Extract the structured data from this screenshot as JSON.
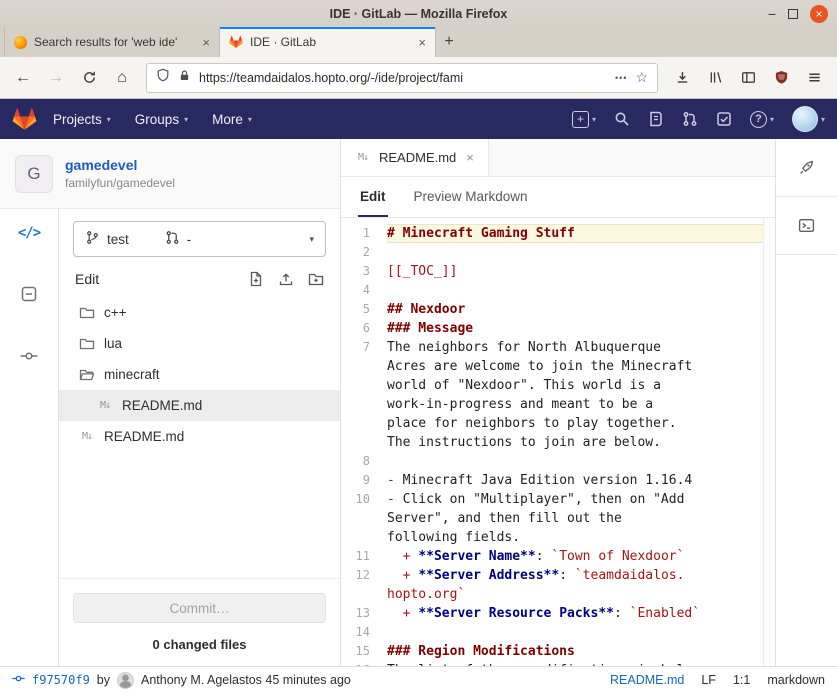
{
  "window": {
    "title": "IDE · GitLab — Mozilla Firefox"
  },
  "browser": {
    "tab1": "Search results for 'web ide'",
    "tab2": "IDE · GitLab",
    "url": "https://teamdaidalos.hopto.org/-/ide/project/fami"
  },
  "glyphs": {
    "back": "←",
    "forward": "→",
    "home": "⌂",
    "bookmark_star": "☆",
    "page_actions": "•••",
    "new_tab": "+",
    "close": "×",
    "caret": "▾",
    "plus": "+",
    "help": "?",
    "minimize": "−",
    "code_mode": "</>",
    "markdown_file": "M↓"
  },
  "gl_nav": {
    "projects": "Projects",
    "groups": "Groups",
    "more": "More"
  },
  "sidebar": {
    "project_initial": "G",
    "project_name": "gamedevel",
    "project_path": "familyfun/gamedevel",
    "branch": "test",
    "mr_value": "-",
    "edit_label": "Edit",
    "commit_button": "Commit…",
    "changed_files": "0 changed files"
  },
  "tree": [
    {
      "type": "folder",
      "name": "c++"
    },
    {
      "type": "folder",
      "name": "lua"
    },
    {
      "type": "folder_open",
      "name": "minecraft"
    },
    {
      "type": "markdown",
      "name": "README.md",
      "selected": true,
      "indent": 1
    },
    {
      "type": "markdown",
      "name": "README.md"
    }
  ],
  "editor": {
    "file_tab": "README.md",
    "tab_edit": "Edit",
    "tab_preview": "Preview Markdown",
    "rows": [
      {
        "n": "1",
        "hl": true,
        "s": [
          [
            "h",
            "# Minecraft Gaming Stuff"
          ]
        ]
      },
      {
        "n": "2",
        "s": []
      },
      {
        "n": "3",
        "s": [
          [
            "r",
            "[[_TOC_]]"
          ]
        ]
      },
      {
        "n": "4",
        "s": []
      },
      {
        "n": "5",
        "s": [
          [
            "h",
            "## Nexdoor"
          ]
        ]
      },
      {
        "n": "6",
        "s": [
          [
            "h",
            "### Message"
          ]
        ]
      },
      {
        "n": "7",
        "s": [
          [
            "t",
            "The neighbors for North Albuquerque"
          ]
        ]
      },
      {
        "n": "",
        "s": [
          [
            "t",
            "Acres are welcome to join the Minecraft"
          ]
        ]
      },
      {
        "n": "",
        "s": [
          [
            "t",
            "world of \"Nexdoor\". This world is a"
          ]
        ]
      },
      {
        "n": "",
        "s": [
          [
            "t",
            "work-in-progress and meant to be a"
          ]
        ]
      },
      {
        "n": "",
        "s": [
          [
            "t",
            "place for neighbors to play together."
          ]
        ]
      },
      {
        "n": "",
        "s": [
          [
            "t",
            "The instructions to join are below."
          ]
        ]
      },
      {
        "n": "8",
        "s": []
      },
      {
        "n": "9",
        "s": [
          [
            "m",
            "- "
          ],
          [
            "t",
            "Minecraft Java Edition version 1.16.4"
          ]
        ]
      },
      {
        "n": "10",
        "s": [
          [
            "m",
            "- "
          ],
          [
            "t",
            "Click on \"Multiplayer\", then on \"Add"
          ]
        ]
      },
      {
        "n": "",
        "s": [
          [
            "t",
            "Server\", and then fill out the"
          ]
        ]
      },
      {
        "n": "",
        "s": [
          [
            "t",
            "following fields."
          ]
        ]
      },
      {
        "n": "11",
        "s": [
          [
            "t",
            "  "
          ],
          [
            "m",
            "+ "
          ],
          [
            "b",
            "**Server Name**"
          ],
          [
            "t",
            ": "
          ],
          [
            "r",
            "`Town of Nexdoor`"
          ]
        ]
      },
      {
        "n": "12",
        "s": [
          [
            "t",
            "  "
          ],
          [
            "m",
            "+ "
          ],
          [
            "b",
            "**Server Address**"
          ],
          [
            "t",
            ": "
          ],
          [
            "r",
            "`teamdaidalos."
          ]
        ]
      },
      {
        "n": "",
        "s": [
          [
            "r",
            "hopto.org`"
          ]
        ]
      },
      {
        "n": "13",
        "s": [
          [
            "t",
            "  "
          ],
          [
            "m",
            "+ "
          ],
          [
            "b",
            "**Server Resource Packs**"
          ],
          [
            "t",
            ": "
          ],
          [
            "r",
            "`Enabled`"
          ]
        ]
      },
      {
        "n": "14",
        "s": []
      },
      {
        "n": "15",
        "s": [
          [
            "h",
            "### Region Modifications"
          ]
        ]
      },
      {
        "n": "16",
        "s": [
          [
            "t",
            "The list of these modifications is below."
          ]
        ]
      }
    ]
  },
  "statusbar": {
    "commit_sha": "f97570f9",
    "by": "by",
    "author": "Anthony M. Agelastos 45 minutes ago",
    "file": "README.md",
    "line_ending": "LF",
    "cursor": "1:1",
    "language": "markdown"
  },
  "colors": {
    "gitlab_navbar": "#292961",
    "tanuki_orange": "#e24329",
    "link_blue": "#1068bf"
  }
}
